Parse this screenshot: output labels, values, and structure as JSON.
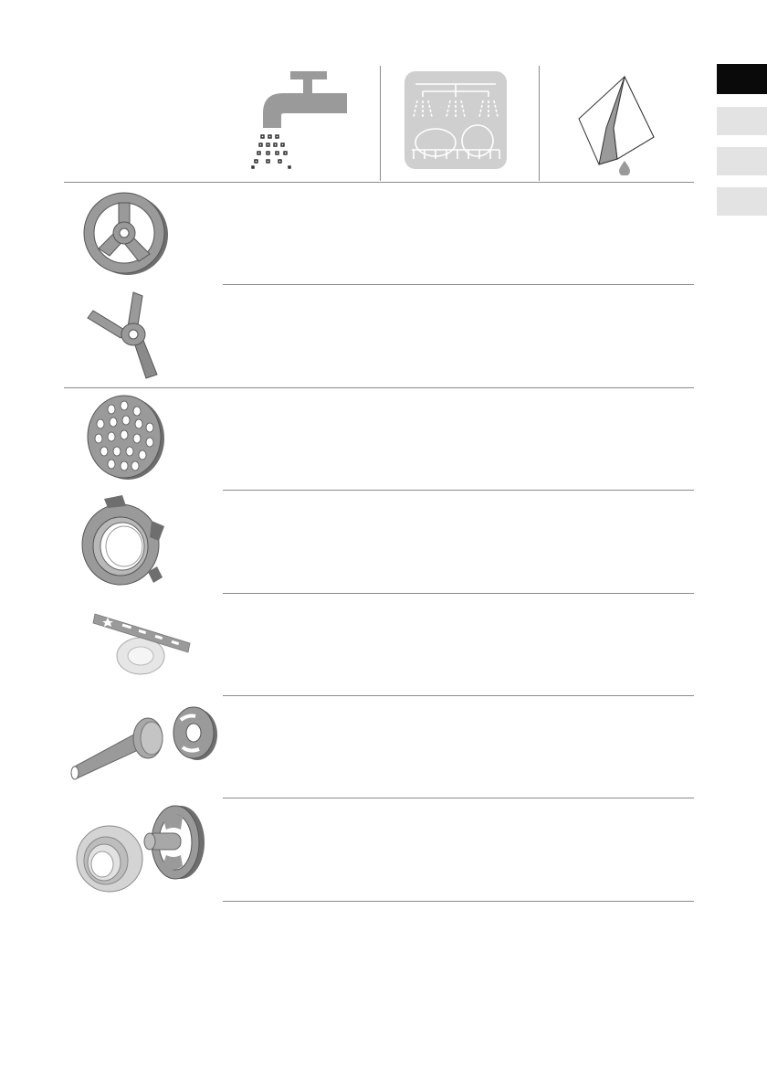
{
  "colors": {
    "page_background": "#ffffff",
    "rule_line": "#8a8a8a",
    "part_fill": "#9a9a9a",
    "part_dark": "#6e6e6e",
    "tab_active": "#0a0a0a",
    "tab_inactive": "#e3e3e3",
    "dishwasher_panel": "#cfcfcf"
  },
  "header_icons": [
    "tap-water-icon",
    "dishwasher-icon",
    "cloth-dry-icon"
  ],
  "side_tabs": [
    {
      "state": "active"
    },
    {
      "state": "inactive"
    },
    {
      "state": "inactive"
    },
    {
      "state": "inactive"
    }
  ],
  "parts": [
    "blade-holder-disc-icon",
    "cutting-blade-icon",
    "perforated-disc-icon",
    "ring-nut-icon",
    "biscuit-attachment-icon",
    "sausage-attachment-icon",
    "kebbe-attachment-icon"
  ],
  "cleaning_table": {
    "groups": 2,
    "rows": 7
  }
}
